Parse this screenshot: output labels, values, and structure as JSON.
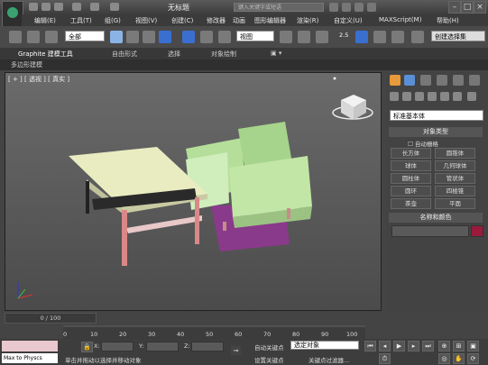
{
  "window": {
    "title": "无标题",
    "search_placeholder": "键入关键字或短语"
  },
  "menu": [
    "编辑(E)",
    "工具(T)",
    "组(G)",
    "视图(V)",
    "创建(C)",
    "修改器",
    "动画",
    "图形编辑器",
    "渲染(R)",
    "自定义(U)",
    "MAXScript(M)",
    "帮助(H)"
  ],
  "toolbar": {
    "filter_value": "全部",
    "ref_coord_value": "视图",
    "snap_angle_label": "2.5",
    "selection_set": "创建选择集"
  },
  "ribbon": {
    "tabs": [
      "Graphite 建模工具",
      "自由形式",
      "选择",
      "对象绘制"
    ],
    "sub_label": "多边形建模"
  },
  "viewport": {
    "label": "[ + ] [ 透视 ] [ 真实 ]"
  },
  "command_panel": {
    "category_value": "标准基本体",
    "object_type_title": "对象类型",
    "autogrid_label": "自动栅格",
    "buttons": [
      "长方体",
      "圆锥体",
      "球体",
      "几何球体",
      "圆柱体",
      "管状体",
      "圆环",
      "四棱锥",
      "茶壶",
      "平面"
    ],
    "name_color_title": "名称和颜色",
    "color_swatch": "#9a1a3c"
  },
  "timeline": {
    "frame_display": "0 / 100",
    "ticks": [
      "0",
      "10",
      "20",
      "30",
      "40",
      "50",
      "60",
      "70",
      "80",
      "90",
      "100"
    ]
  },
  "status": {
    "maxscript_text": "Max to Physcs",
    "prompt": "单击并拖动以选择并移动对象",
    "x_label": "X:",
    "y_label": "Y:",
    "z_label": "Z:",
    "autokey_label": "自动关键点",
    "setkey_label": "设置关键点",
    "selected_value": "选定对象",
    "keyfilter_label": "关键点过滤器..."
  },
  "colors": {
    "sofa": "#c2e6a6",
    "table_top": "#e8ecc0",
    "table_legs": "#d98888"
  }
}
